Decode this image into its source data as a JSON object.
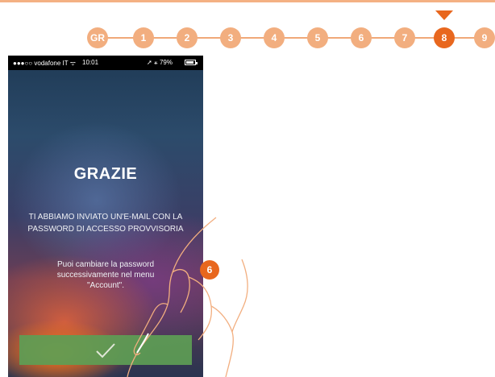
{
  "stepper": {
    "steps": [
      "GR",
      "1",
      "2",
      "3",
      "4",
      "5",
      "6",
      "7",
      "8",
      "9"
    ],
    "active_step": "8"
  },
  "phone": {
    "status_bar": {
      "carrier": "●●●○○ vodafone IT ᯤ",
      "time": "10:01",
      "battery": "➚ ⚹ 79%"
    },
    "title": "GRAZIE",
    "message": "TI ABBIAMO INVIATO UN'E-MAIL CON LA PASSWORD DI ACCESSO PROVVISORIA",
    "hint_lines": [
      "Puoi cambiare la password",
      "successivamente nel menu",
      "\"Account\"."
    ],
    "confirm_icon": "checkmark-icon"
  },
  "callout": {
    "label": "6"
  },
  "colors": {
    "accent": "#e8671e",
    "step_inactive": "#f2ae7f",
    "confirm_green": "#5e9e55"
  }
}
